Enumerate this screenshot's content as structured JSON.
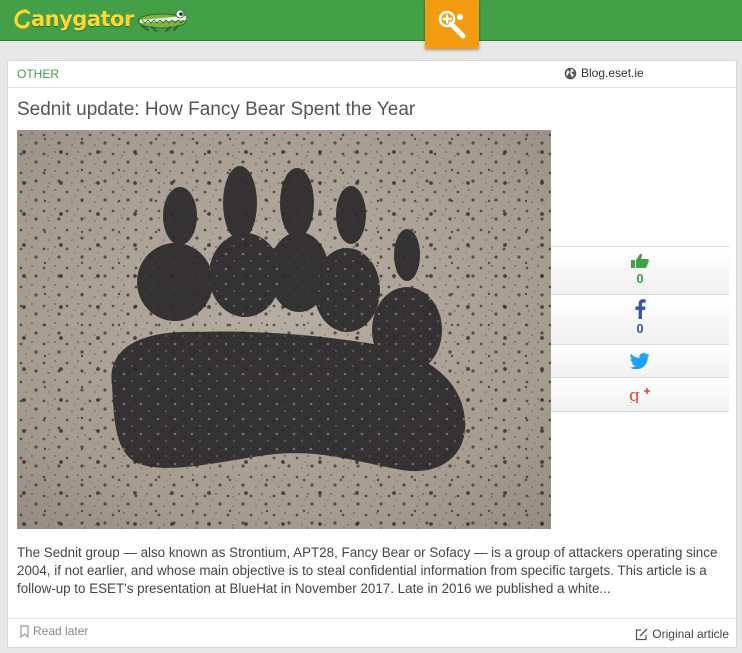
{
  "brand": {
    "name": "anygator"
  },
  "header": {
    "feature_icon": "bookmark-compose-icon",
    "accent": "#f39c12",
    "bar_color": "#43a047"
  },
  "article": {
    "category": "OTHER",
    "source": "Blog.eset.ie",
    "title": "Sednit update: How Fancy Bear Spent the Year",
    "image_alt": "Black bear paw print on speckled concrete",
    "excerpt": "The Sednit group — also known as Strontium, APT28, Fancy Bear or Sofacy — is a group of attackers operating since 2004, if not earlier, and whose main objective is to steal confidential information from specific targets. This article is a follow-up to ESET's presentation at BlueHat in November 2017. Late in 2016 we published a white...",
    "read_later_label": "Read later",
    "original_label": "Original article"
  },
  "social": {
    "likes": {
      "icon": "thumbs-up-icon",
      "count": "0",
      "color": "#43a047"
    },
    "facebook": {
      "icon": "facebook-icon",
      "count": "0",
      "color": "#3b5998"
    },
    "twitter": {
      "icon": "twitter-icon",
      "color": "#1da1f2"
    },
    "google_plus": {
      "icon": "google-plus-icon",
      "color": "#dd4b39"
    }
  }
}
